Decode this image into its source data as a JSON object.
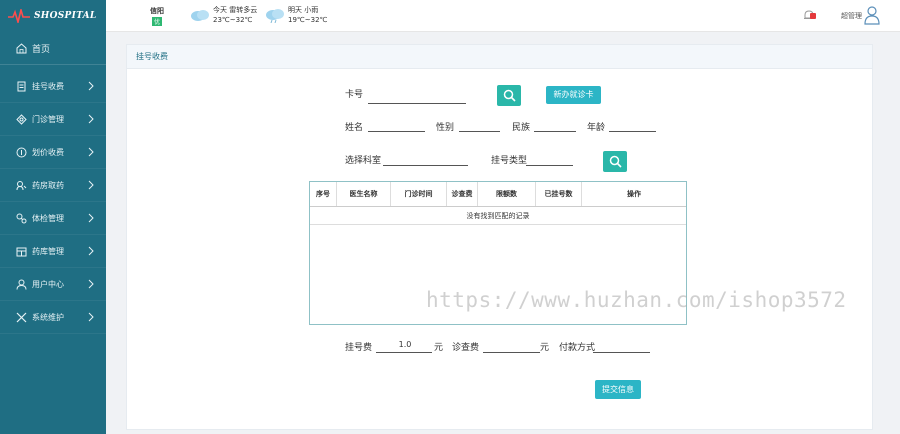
{
  "app": {
    "logo_text": "SHOSPITAL",
    "city": "信阳",
    "aqi": "优",
    "weather_today": {
      "line1": "今天  雷转多云",
      "line2": "23℃~32℃"
    },
    "weather_tomorrow": {
      "line1": "明天  小雨",
      "line2": "19℃~32℃"
    },
    "admin": "超管理"
  },
  "sidebar": {
    "home": "首页",
    "items": [
      {
        "label": "挂号收费",
        "icon": "register-icon"
      },
      {
        "label": "门诊管理",
        "icon": "outpatient-icon"
      },
      {
        "label": "划价收费",
        "icon": "pricing-icon"
      },
      {
        "label": "药房取药",
        "icon": "pharmacy-icon"
      },
      {
        "label": "体检管理",
        "icon": "checkup-icon"
      },
      {
        "label": "药库管理",
        "icon": "warehouse-icon"
      },
      {
        "label": "用户中心",
        "icon": "user-icon"
      },
      {
        "label": "系统维护",
        "icon": "tools-icon"
      }
    ]
  },
  "panel": {
    "title": "挂号收费",
    "card_no_label": "卡号",
    "new_card_button": "新办就诊卡",
    "name_label": "姓名",
    "gender_label": "性别",
    "ethnicity_label": "民族",
    "age_label": "年龄",
    "dept_label": "选择科室",
    "reg_type_label": "挂号类型",
    "table": {
      "headers": [
        "序号",
        "医生名称",
        "门诊时间",
        "诊查费",
        "限额数",
        "已挂号数",
        "操作"
      ],
      "empty_text": "没有找到匹配的记录"
    },
    "reg_fee_label": "挂号费",
    "reg_fee_value": "1.0",
    "yuan": "元",
    "exam_fee_label": "诊查费",
    "payment_label": "付款方式",
    "submit_button": "提交信息"
  },
  "watermark": "https://www.huzhan.com/ishop3572",
  "colors": {
    "sidebar": "#1f6e83",
    "accent": "#2ab7a9",
    "button": "#2cb5c6"
  }
}
